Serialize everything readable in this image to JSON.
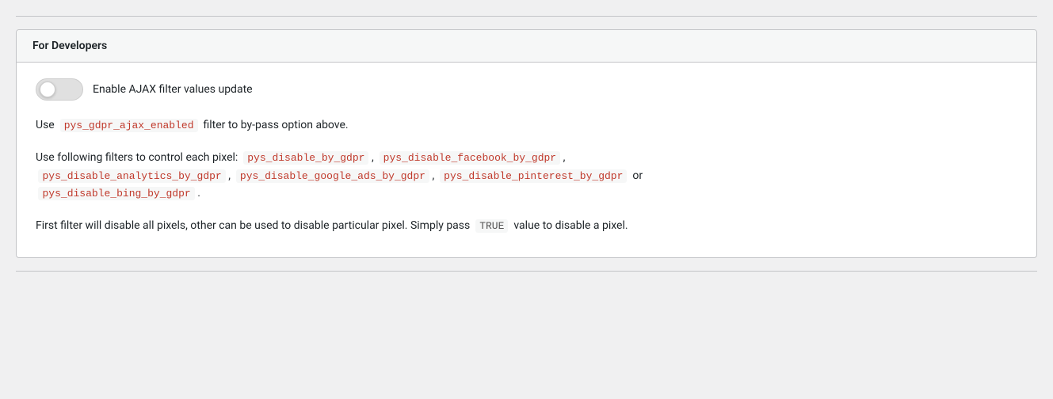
{
  "card": {
    "header_title": "For Developers",
    "toggle_label": "Enable AJAX filter values update",
    "line1_prefix": "Use",
    "line1_code": "pys_gdpr_ajax_enabled",
    "line1_suffix": "filter to by-pass option above.",
    "line2_prefix": "Use following filters to control each pixel:",
    "line2_codes": [
      "pys_disable_by_gdpr",
      "pys_disable_facebook_by_gdpr",
      "pys_disable_analytics_by_gdpr",
      "pys_disable_google_ads_by_gdpr",
      "pys_disable_pinterest_by_gdpr",
      "pys_disable_bing_by_gdpr"
    ],
    "line3_prefix": "First filter will disable all pixels, other can be used to disable particular pixel. Simply pass",
    "line3_code": "TRUE",
    "line3_suffix": "value to disable a pixel."
  }
}
